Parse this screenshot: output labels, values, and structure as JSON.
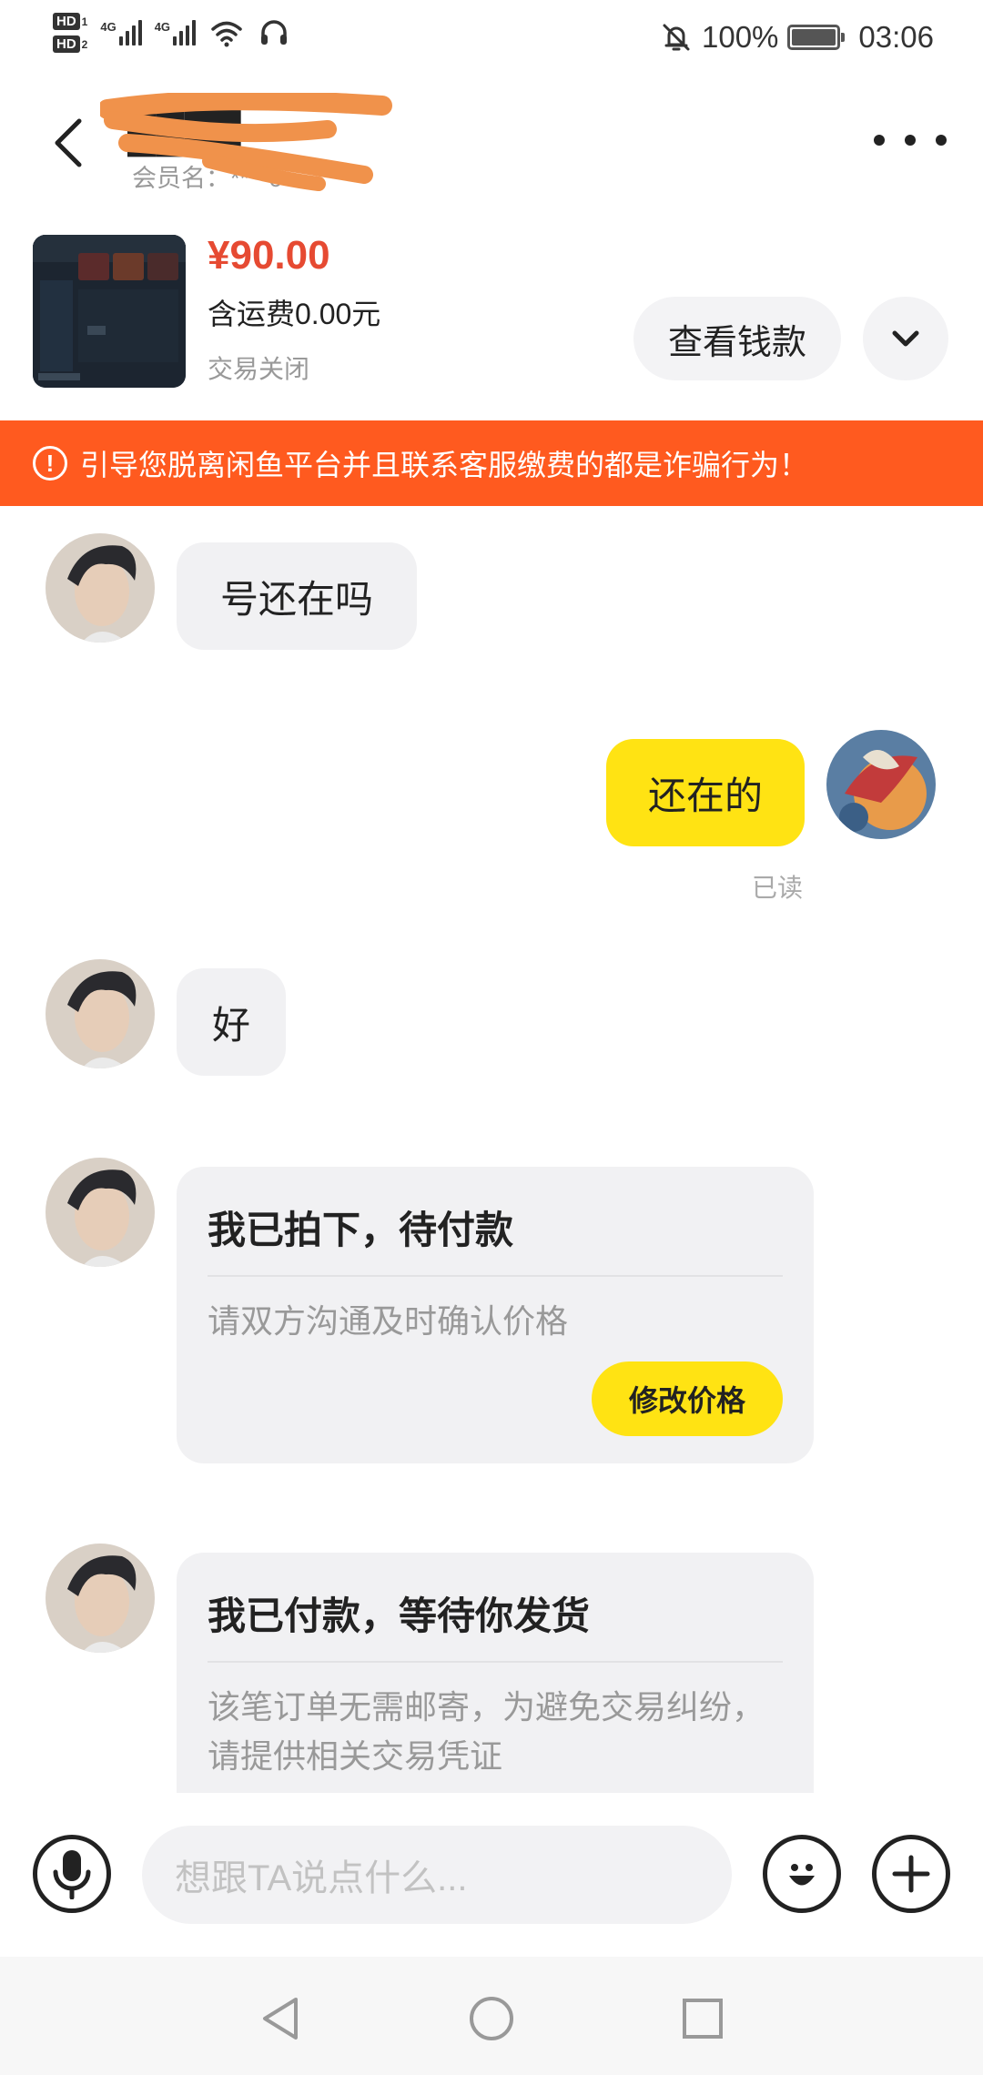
{
  "status_bar": {
    "hd1": "HD",
    "hd1_sub": "1",
    "hd2": "HD",
    "hd2_sub": "2",
    "net1": "4G",
    "net2": "4G",
    "battery_percent": "100%",
    "time": "03:06"
  },
  "header": {
    "title": "████",
    "subtitle": "会员名：****6"
  },
  "product": {
    "price": "¥90.00",
    "shipping": "含运费0.00元",
    "status": "交易关闭",
    "view_button": "查看钱款"
  },
  "warning": {
    "icon": "!",
    "text": "引导您脱离闲鱼平台并且联系客服缴费的都是诈骗行为！"
  },
  "messages": [
    {
      "side": "left",
      "text": "号还在吗"
    },
    {
      "side": "right",
      "text": "还在的",
      "read_label": "已读"
    },
    {
      "side": "left",
      "text": "好"
    }
  ],
  "cards": [
    {
      "title": "我已拍下，待付款",
      "desc": "请双方沟通及时确认价格",
      "button": "修改价格"
    },
    {
      "title": "我已付款，等待你发货",
      "desc": "该笔订单无需邮寄，为避免交易纠纷，请提供相关交易凭证"
    }
  ],
  "input_bar": {
    "placeholder": "想跟TA说点什么..."
  },
  "icons": {
    "back": "chevron-left-icon",
    "more": "more-icon",
    "expand": "chevron-down-icon",
    "voice": "microphone-icon",
    "emoji": "emoji-icon",
    "add": "plus-icon",
    "nav_back": "triangle-back-icon",
    "nav_home": "circle-home-icon",
    "nav_recent": "square-recent-icon"
  },
  "colors": {
    "price": "#e64a32",
    "warning_bg": "#ff5a1f",
    "accent_yellow": "#ffe313"
  }
}
